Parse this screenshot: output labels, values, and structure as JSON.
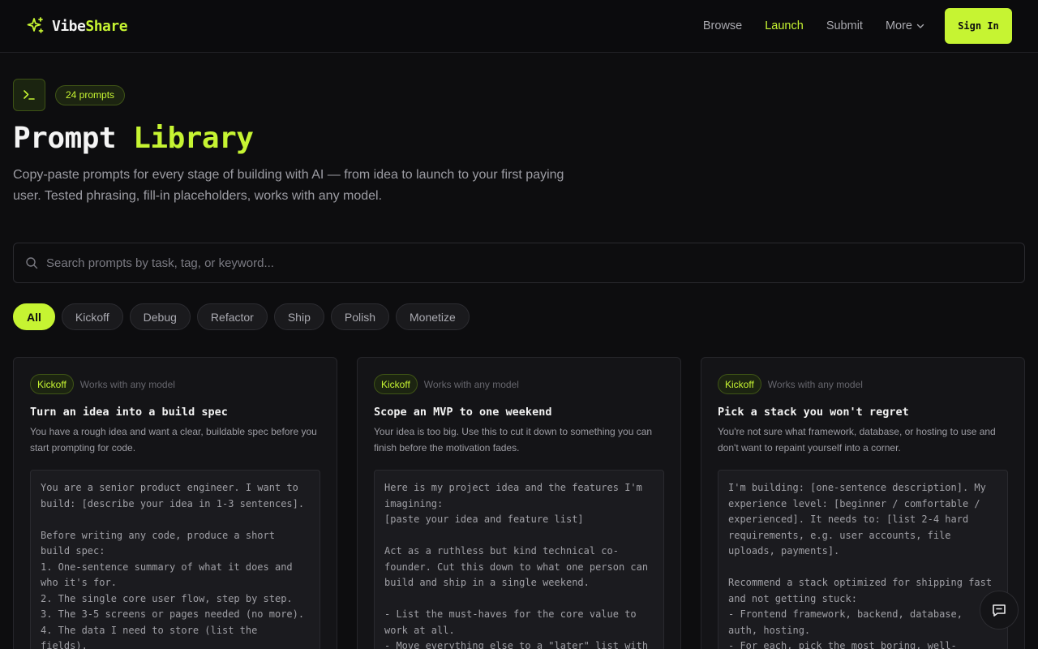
{
  "brand": {
    "name_part1": "Vibe",
    "name_part2": "Share"
  },
  "nav": {
    "items": [
      {
        "label": "Browse"
      },
      {
        "label": "Launch"
      },
      {
        "label": "Submit"
      },
      {
        "label": "More"
      }
    ],
    "signin_label": "Sign In"
  },
  "hero": {
    "count_label": "24 prompts",
    "title_part1": "Prompt",
    "title_part2": "Library",
    "subtitle": "Copy-paste prompts for every stage of building with AI — from idea to launch to your first paying user. Tested phrasing, fill-in placeholders, works with any model."
  },
  "search": {
    "placeholder": "Search prompts by task, tag, or keyword..."
  },
  "filters": [
    "All",
    "Kickoff",
    "Debug",
    "Refactor",
    "Ship",
    "Polish",
    "Monetize"
  ],
  "cards": [
    {
      "tag": "Kickoff",
      "model": "Works with any model",
      "title": "Turn an idea into a build spec",
      "desc": "You have a rough idea and want a clear, buildable spec before you start prompting for code.",
      "code": "You are a senior product engineer. I want to build: [describe your idea in 1-3 sentences].\n\nBefore writing any code, produce a short build spec:\n1. One-sentence summary of what it does and who it's for.\n2. The single core user flow, step by step.\n3. The 3-5 screens or pages needed (no more).\n4. The data I need to store (list the fields)."
    },
    {
      "tag": "Kickoff",
      "model": "Works with any model",
      "title": "Scope an MVP to one weekend",
      "desc": "Your idea is too big. Use this to cut it down to something you can finish before the motivation fades.",
      "code": "Here is my project idea and the features I'm imagining:\n[paste your idea and feature list]\n\nAct as a ruthless but kind technical co-founder. Cut this down to what one person can build and ship in a single weekend.\n\n- List the must-haves for the core value to work at all.\n- Move everything else to a \"later\" list with"
    },
    {
      "tag": "Kickoff",
      "model": "Works with any model",
      "title": "Pick a stack you won't regret",
      "desc": "You're not sure what framework, database, or hosting to use and don't want to repaint yourself into a corner.",
      "code": "I'm building: [one-sentence description]. My experience level: [beginner / comfortable / experienced]. It needs to: [list 2-4 hard requirements, e.g. user accounts, file uploads, payments].\n\nRecommend a stack optimized for shipping fast and not getting stuck:\n- Frontend framework, backend, database, auth, hosting.\n- For each, pick the most boring, well-"
    }
  ]
}
